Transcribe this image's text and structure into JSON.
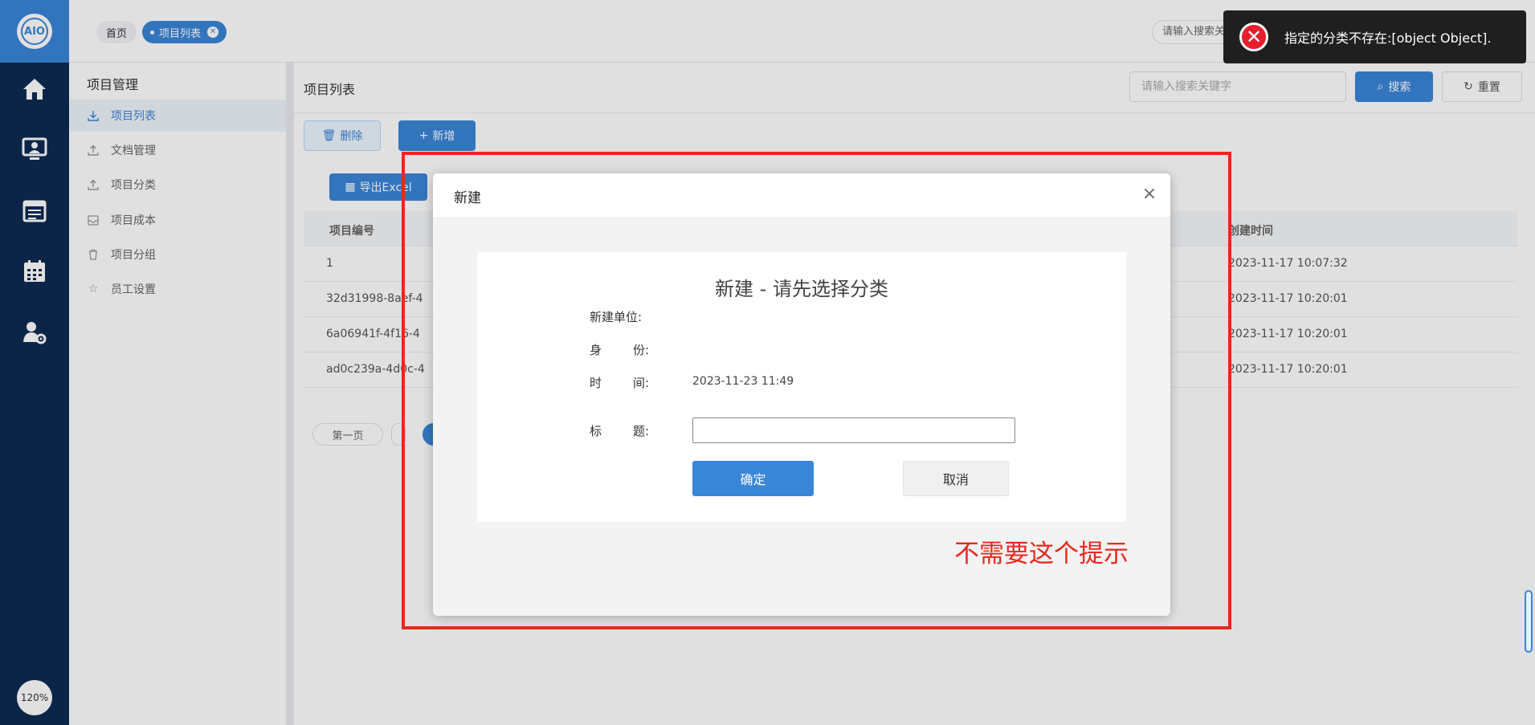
{
  "rail": {
    "logo_text": "AIO",
    "zoom": "120%",
    "icons": [
      "home-icon",
      "monitor-user-icon",
      "calendar-list-icon",
      "calendar-grid-icon",
      "user-settings-icon"
    ]
  },
  "topbar": {
    "tabs": [
      {
        "label": "首页"
      },
      {
        "label": "项目列表"
      }
    ],
    "search_placeholder": "请输入搜索关"
  },
  "sidebar": {
    "title": "项目管理",
    "items": [
      {
        "label": "项目列表",
        "icon": "download-icon"
      },
      {
        "label": "文档管理",
        "icon": "upload-icon"
      },
      {
        "label": "项目分类",
        "icon": "upload-icon"
      },
      {
        "label": "项目成本",
        "icon": "inbox-icon"
      },
      {
        "label": "项目分组",
        "icon": "trash-icon"
      },
      {
        "label": "员工设置",
        "icon": "star-icon"
      }
    ]
  },
  "main": {
    "title": "项目列表",
    "search_placeholder": "请输入搜索关键字",
    "search_btn": "搜索",
    "reset_btn": "重置",
    "delete_btn": "删除",
    "add_btn": "新增",
    "export_btn": "导出Excel",
    "table": {
      "headers": [
        "项目编号",
        "创建时间"
      ],
      "rows": [
        {
          "id": "1",
          "time": "2023-11-17 10:07:32"
        },
        {
          "id": "32d31998-8aef-4",
          "time": "2023-11-17 10:20:01"
        },
        {
          "id": "6a06941f-4f16-4",
          "time": "2023-11-17 10:20:01"
        },
        {
          "id": "ad0c239a-4d0c-4",
          "time": "2023-11-17 10:20:01"
        }
      ]
    },
    "pager_first": "第一页"
  },
  "modal": {
    "title": "新建",
    "close": "×",
    "card_title": "新建 - 请先选择分类",
    "labels": {
      "unit": "新建单位:",
      "identity_a": "身",
      "identity_b": "份:",
      "time_a": "时",
      "time_b": "间:",
      "title_a": "标",
      "title_b": "题:"
    },
    "time_value": "2023-11-23 11:49",
    "title_value": "",
    "ok_btn": "确定",
    "cancel_btn": "取消"
  },
  "annotation": {
    "note": "不需要这个提示",
    "color": "#e8281e"
  },
  "toast": {
    "message": "指定的分类不存在:[object Object]."
  },
  "colors": {
    "primary": "#3a86d8",
    "rail": "#0d2b54",
    "error": "#e81e2c"
  }
}
